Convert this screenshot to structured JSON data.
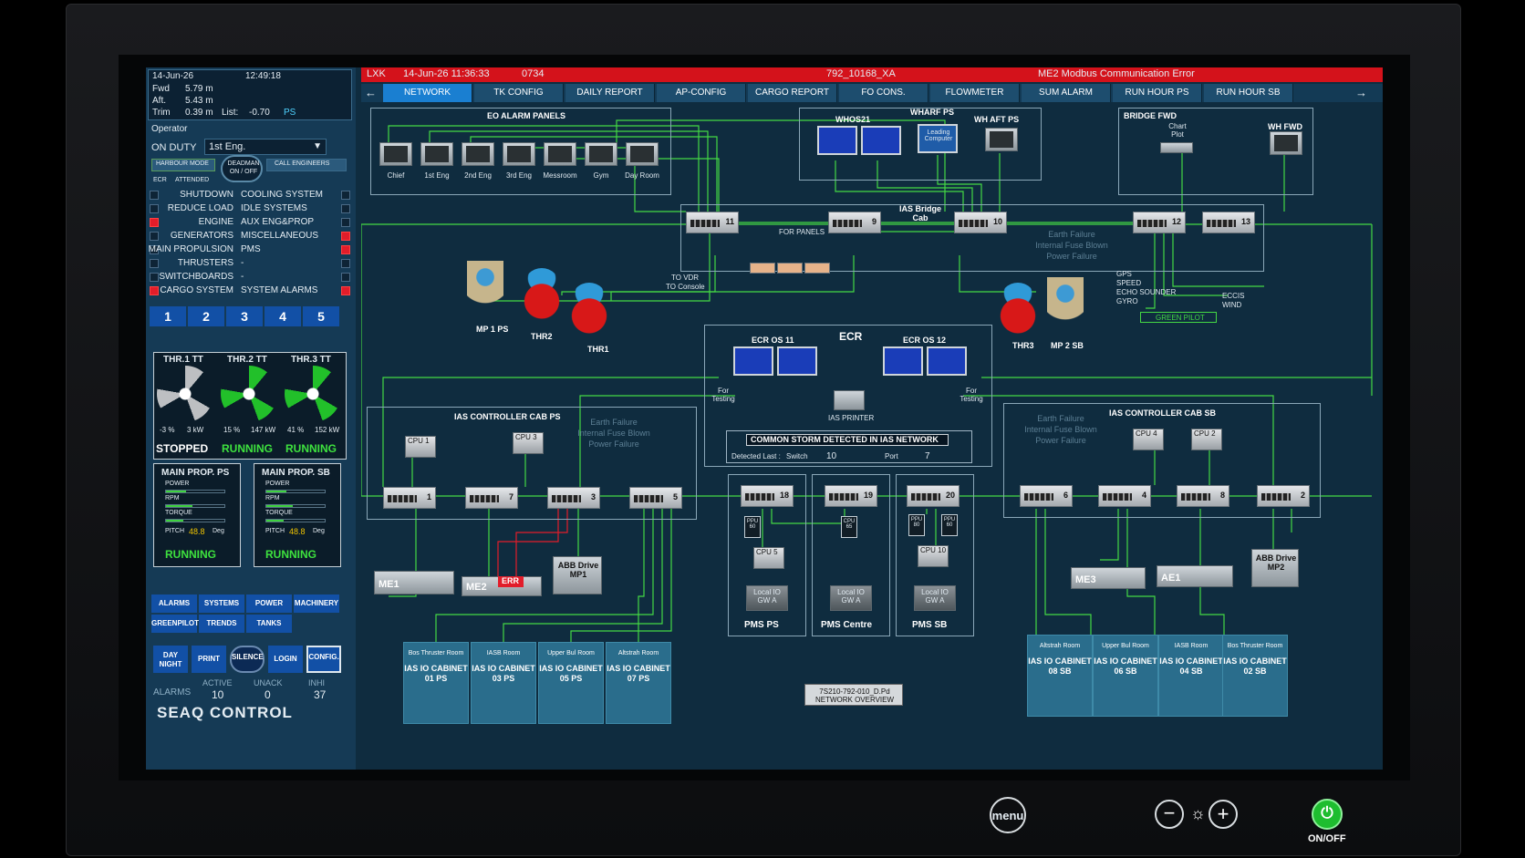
{
  "left": {
    "date": "14-Jun-26",
    "time": "12:49:18",
    "draft": [
      {
        "k": "Fwd",
        "v": "5.79 m"
      },
      {
        "k": "Aft.",
        "v": "5.43 m"
      },
      {
        "k": "Trim",
        "v": "0.39 m"
      }
    ],
    "list_label": "List:",
    "list_value": "-0.70",
    "list_unit": "PS",
    "operator_label": "Operator",
    "on_duty_label": "ON DUTY",
    "on_duty_value": "1st Eng.",
    "harbour_mode": "HARBOUR MODE",
    "deadman": "DEADMAN ON / OFF",
    "call_engineers": "CALL ENGINEERS",
    "ecr": "ECR",
    "attended": "ATTENDED",
    "groups": [
      {
        "l": "SHUTDOWN",
        "r": "COOLING SYSTEM",
        "lred": false,
        "rred": false
      },
      {
        "l": "REDUCE LOAD",
        "r": "IDLE SYSTEMS",
        "lred": false,
        "rred": false
      },
      {
        "l": "ENGINE",
        "r": "AUX ENG&PROP",
        "lred": true,
        "rred": false
      },
      {
        "l": "GENERATORS",
        "r": "MISCELLANEOUS",
        "lred": false,
        "rred": true
      },
      {
        "l": "MAIN PROPULSION",
        "r": "PMS",
        "lred": false,
        "rred": true
      },
      {
        "l": "THRUSTERS",
        "r": "-",
        "lred": false,
        "rred": false
      },
      {
        "l": "SWITCHBOARDS",
        "r": "-",
        "lred": false,
        "rred": false
      },
      {
        "l": "CARGO SYSTEM",
        "r": "SYSTEM ALARMS",
        "lred": true,
        "rred": true
      }
    ],
    "pages": [
      "1",
      "2",
      "3",
      "4",
      "5"
    ],
    "thrusters": [
      {
        "name": "THR.1 TT",
        "pct": "-3 %",
        "kw": "3 kW",
        "state": "STOPPED",
        "color": "#bdbfc2"
      },
      {
        "name": "THR.2 TT",
        "pct": "15 %",
        "kw": "147 kW",
        "state": "RUNNING",
        "color": "#22c02a"
      },
      {
        "name": "THR.3 TT",
        "pct": "41 %",
        "kw": "152 kW",
        "state": "RUNNING",
        "color": "#22c02a"
      }
    ],
    "props": [
      {
        "title": "MAIN PROP. PS",
        "power": "POWER",
        "rpm": "RPM",
        "torque": "TORQUE",
        "pitch": "PITCH",
        "pitch_v": "48.8",
        "unit": "Deg",
        "state": "RUNNING",
        "power_level": 0.35,
        "rpm_level": 0.45,
        "torque_level": 0.3
      },
      {
        "title": "MAIN PROP. SB",
        "power": "POWER",
        "rpm": "RPM",
        "torque": "TORQUE",
        "pitch": "PITCH",
        "pitch_v": "48.8",
        "unit": "Deg",
        "state": "RUNNING",
        "power_level": 0.35,
        "rpm_level": 0.45,
        "torque_level": 0.3
      }
    ],
    "nav1": [
      "ALARMS",
      "SYSTEMS",
      "POWER",
      "MACHINERY"
    ],
    "nav2": [
      "GREENPILOT",
      "TRENDS",
      "TANKS"
    ],
    "tools": [
      "DAY NIGHT",
      "PRINT",
      "SILENCE",
      "LOGIN",
      "CONFIG."
    ],
    "alarms_label": "ALARMS",
    "active_label": "ACTIVE",
    "unack_label": "UNACK",
    "inhi_label": "INHI",
    "active": "10",
    "unack": "0",
    "inhi": "37",
    "brand": "SEAQ CONTROL"
  },
  "topbar": {
    "code": "LXK",
    "datetime": "14-Jun-26  11:36:33",
    "num": "0734",
    "id": "792_10168_XA",
    "error": "ME2 Modbus Communication Error"
  },
  "tabs": [
    "NETWORK",
    "TK CONFIG",
    "DAILY REPORT",
    "AP-CONFIG",
    "CARGO REPORT",
    "FO CONS.",
    "FLOWMETER",
    "SUM ALARM",
    "RUN HOUR PS",
    "RUN HOUR SB"
  ],
  "net": {
    "eo_title": "EO ALARM PANELS",
    "eo_panels": [
      "Chief",
      "1st Eng",
      "2nd Eng",
      "3rd Eng",
      "Messroom",
      "Gym",
      "Day Room"
    ],
    "whos": "WHOS21",
    "wharf": "WHARF PS",
    "leading": "Leading Computer",
    "wh_aft": "WH AFT PS",
    "bridge_fwd": "BRIDGE FWD",
    "chart_plot": "Chart Plot",
    "wh_fwd": "WH FWD",
    "ias_bridge": "IAS Bridge Cab",
    "for_panels": "FOR PANELS",
    "to_vdr": "TO VDR",
    "to_console": "TO Console",
    "failures": [
      "Earth Failure",
      "Internal Fuse Blown",
      "Power Failure"
    ],
    "nav_inputs": [
      "GPS",
      "SPEED",
      "ECHO SOUNDER",
      "GYRO"
    ],
    "eccis": "ECCIS",
    "wind": "WIND",
    "green_pilot": "GREEN PILOT",
    "mp1": "MP 1 PS",
    "mp2": "MP 2 SB",
    "thr2": "THR2",
    "thr1": "THR1",
    "thr3": "THR3",
    "ecr": "ECR",
    "ecr_os11": "ECR OS 11",
    "ecr_os12": "ECR OS 12",
    "for_testing": "For Testing",
    "ias_printer": "IAS PRINTER",
    "storm": "COMMON STORM DETECTED IN IAS NETWORK",
    "detected_last": "Detected Last :",
    "switch_label": "Switch",
    "switch_val": "10",
    "port_label": "Port",
    "port_val": "7",
    "ctrl_ps": "IAS CONTROLLER CAB PS",
    "ctrl_sb": "IAS CONTROLLER CAB SB",
    "switches": [
      "11",
      "9",
      "10",
      "12",
      "13",
      "1",
      "7",
      "3",
      "5",
      "18",
      "19",
      "20",
      "6",
      "4",
      "8",
      "2"
    ],
    "cpus_ps": [
      "CPU 1",
      "CPU 3"
    ],
    "cpus_sb": [
      "CPU 4",
      "CPU 2"
    ],
    "pms": [
      "PMS PS",
      "PMS Centre",
      "PMS SB"
    ],
    "pms_cpu": [
      "CPU 5",
      "CPU 10"
    ],
    "ppu": [
      "PPU 60",
      "CPU 65",
      "PPU 80",
      "PPU 60"
    ],
    "local_io": "Local IO GW A",
    "me1": "ME1",
    "me2": "ME2",
    "err": "ERR",
    "abb1": "ABB Drive MP1",
    "abb2": "ABB Drive MP2",
    "me3": "ME3",
    "ae1": "AE1",
    "cabinets": [
      {
        "room": "Bos Thruster Room",
        "name": "IAS IO CABINET 01 PS"
      },
      {
        "room": "IASB Room",
        "name": "IAS IO CABINET 03 PS"
      },
      {
        "room": "Upper Bul Room",
        "name": "IAS IO CABINET 05 PS"
      },
      {
        "room": "Altstrah Room",
        "name": "IAS IO CABINET 07 PS"
      },
      {
        "room": "Altstrah Room",
        "name": "IAS IO CABINET 08 SB"
      },
      {
        "room": "Upper Bul Room",
        "name": "IAS IO CABINET 06 SB"
      },
      {
        "room": "IASB Room",
        "name": "IAS IO CABINET 04 SB"
      },
      {
        "room": "Bos Thruster Room",
        "name": "IAS IO CABINET 02 SB"
      }
    ],
    "drawing": "7S210-792-010_D.Pd NETWORK OVERVIEW"
  },
  "bezel": {
    "menu": "menu",
    "onoff": "ON/OFF"
  },
  "colors": {
    "alarm_red": "#e21d2a",
    "network_green": "#44d844",
    "tab_active": "#1a7fd1",
    "running": "#3ee23e"
  }
}
